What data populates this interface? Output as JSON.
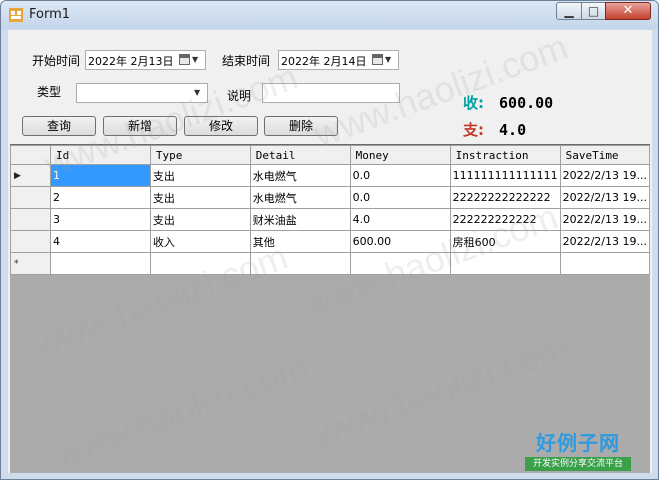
{
  "window": {
    "title": "Form1"
  },
  "filters": {
    "start_label": "开始时间",
    "start_value": "2022年 2月13日",
    "end_label": "结束时间",
    "end_value": "2022年 2月14日",
    "type_label": "类型",
    "type_value": "",
    "desc_label": "说明",
    "desc_value": ""
  },
  "summary": {
    "income_label": "收:",
    "income_value": "600.00",
    "income_color": "#00a0a0",
    "expense_label": "支:",
    "expense_value": "4.0",
    "expense_color": "#c0392b"
  },
  "buttons": {
    "query": "查询",
    "add": "新增",
    "edit": "修改",
    "delete": "删除"
  },
  "grid": {
    "columns": [
      "Id",
      "Type",
      "Detail",
      "Money",
      "Instraction",
      "SaveTime"
    ],
    "rows": [
      [
        "1",
        "支出",
        "水电燃气",
        "0.0",
        "111111111111111",
        "2022/2/13 19..."
      ],
      [
        "2",
        "支出",
        "水电燃气",
        "0.0",
        "22222222222222",
        "2022/2/13 19..."
      ],
      [
        "3",
        "支出",
        "财米油盐",
        "4.0",
        "222222222222",
        "2022/2/13 19..."
      ],
      [
        "4",
        "收入",
        "其他",
        "600.00",
        "房租600",
        "2022/2/13 19..."
      ]
    ],
    "current_row_glyph": "▶",
    "new_row_glyph": "*"
  },
  "watermark": {
    "text": "www.haolizi.com"
  },
  "logo": {
    "main": "好例子网",
    "sub": "开发实例分享交流平台"
  }
}
